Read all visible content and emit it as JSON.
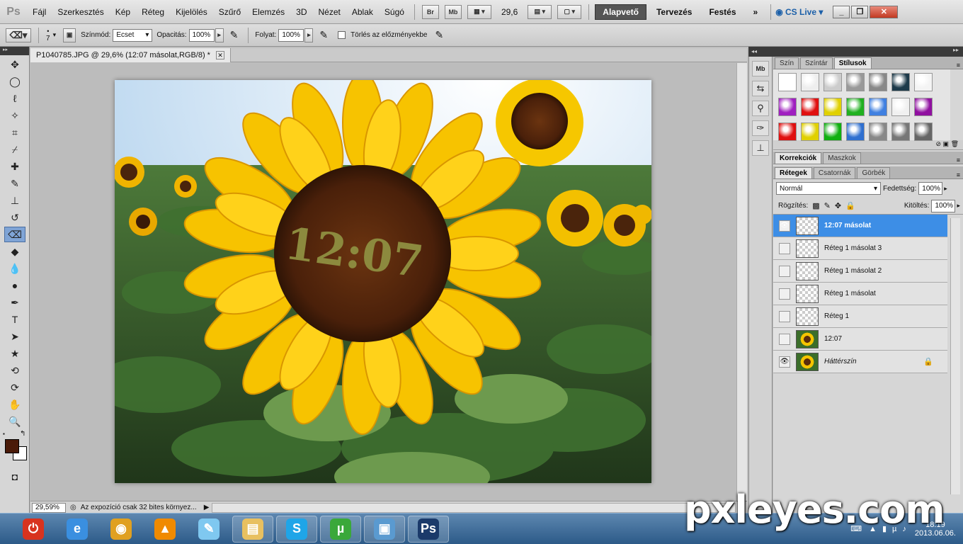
{
  "app": {
    "logo": "Ps"
  },
  "menu": [
    "Fájl",
    "Szerkesztés",
    "Kép",
    "Réteg",
    "Kijelölés",
    "Szűrő",
    "Elemzés",
    "3D",
    "Nézet",
    "Ablak",
    "Súgó"
  ],
  "menubar_tools": {
    "br": "Br",
    "mb": "Mb",
    "zoom": "29,6"
  },
  "workspaces": [
    {
      "label": "Alapvető",
      "active": true
    },
    {
      "label": "Tervezés",
      "active": false
    },
    {
      "label": "Festés",
      "active": false
    }
  ],
  "more_workspaces": "»",
  "cs_live": "CS Live",
  "window_controls": {
    "minimize": "_",
    "restore": "❐",
    "close": "✕"
  },
  "options": {
    "brush_size": "7",
    "mode_label": "Színmód:",
    "mode_value": "Ecset",
    "opacity_label": "Opacitás:",
    "opacity_value": "100%",
    "flow_label": "Folyat:",
    "flow_value": "100%",
    "erase_history_label": "Törlés az előzményekbe"
  },
  "document": {
    "tab_title": "P1040785.JPG @ 29,6% (12:07 másolat,RGB/8) *",
    "overlay_text": "12:07"
  },
  "status": {
    "zoom": "29,59%",
    "info": "Az expozíció csak 32 bites környez..."
  },
  "styles_panel": {
    "tabs": [
      {
        "label": "Szín",
        "active": false
      },
      {
        "label": "Színtár",
        "active": false
      },
      {
        "label": "Stílusok",
        "active": true
      }
    ]
  },
  "swatches": [
    "#ffffff",
    "#eeeeee",
    "#cccccc",
    "#999999",
    "#888888",
    "#1d3a4a",
    "#f4f4f4",
    "#a020c0",
    "#e01010",
    "#e0d000",
    "#20b020",
    "#4080e0",
    "#f0f0f0",
    "#9010a0",
    "#e01010",
    "#e0d000",
    "#10b010",
    "#3070d0",
    "#888888",
    "#777777",
    "#666666"
  ],
  "adjust_panel": {
    "tabs": [
      {
        "label": "Korrekciók",
        "active": true
      },
      {
        "label": "Maszkok",
        "active": false
      }
    ]
  },
  "layers_panel": {
    "tabs": [
      {
        "label": "Rétegek",
        "active": true
      },
      {
        "label": "Csatornák",
        "active": false
      },
      {
        "label": "Görbék",
        "active": false
      }
    ],
    "blend_mode": "Normál",
    "opacity_label": "Fedettség:",
    "opacity_value": "100%",
    "lock_label": "Rögzítés:",
    "fill_label": "Kitöltés:",
    "fill_value": "100%",
    "layers": [
      {
        "name": "12:07 másolat",
        "visible": true,
        "selected": true,
        "thumb": "empty"
      },
      {
        "name": "Réteg 1 másolat 3",
        "visible": false,
        "selected": false,
        "thumb": "empty"
      },
      {
        "name": "Réteg 1 másolat 2",
        "visible": false,
        "selected": false,
        "thumb": "empty"
      },
      {
        "name": "Réteg 1 másolat",
        "visible": false,
        "selected": false,
        "thumb": "empty"
      },
      {
        "name": "Réteg 1",
        "visible": false,
        "selected": false,
        "thumb": "empty"
      },
      {
        "name": "12:07",
        "visible": false,
        "selected": false,
        "thumb": "image"
      },
      {
        "name": "Háttérszín",
        "visible": true,
        "selected": false,
        "thumb": "image",
        "locked": true
      }
    ]
  },
  "taskbar": {
    "items": [
      "power-icon",
      "ie-icon",
      "chrome-icon",
      "vlc-icon",
      "notepad-icon",
      "explorer-icon",
      "skype-icon",
      "utorrent-icon",
      "photos-icon",
      "photoshop-icon"
    ],
    "clock": "18:19",
    "date": "2013.06.06."
  },
  "watermark": "pxleyes.com"
}
